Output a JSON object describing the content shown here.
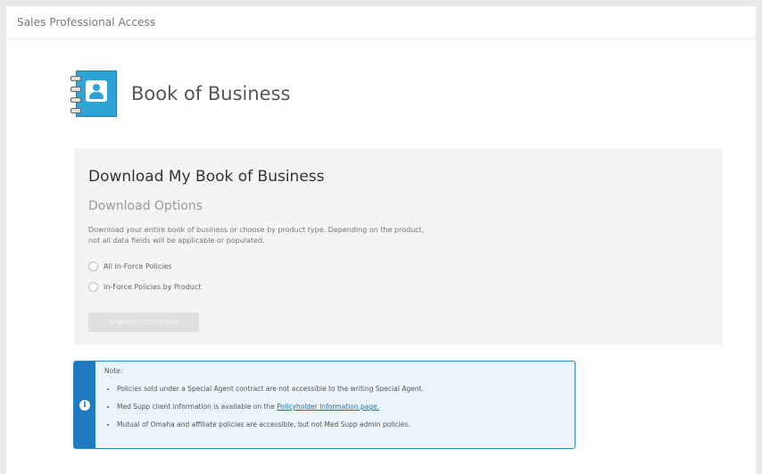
{
  "header": {
    "title": "Sales Professional Access"
  },
  "page": {
    "title": "Book of Business",
    "icon": "address-book-icon",
    "icon_color": "#2ea3d6"
  },
  "download": {
    "title": "Download My Book of Business",
    "subtitle": "Download Options",
    "description": "Download your entire book of business or choose by product type. Depending on the product, not all data fields will be applicable or populated.",
    "options": [
      {
        "label": "All In-Force Policies",
        "selected": false
      },
      {
        "label": "In-Force Policies by Product",
        "selected": false
      }
    ],
    "button_label": "Download CSV to save"
  },
  "note": {
    "label": "Note:",
    "icon": "info-icon",
    "accent_color": "#1f7bc1",
    "items": [
      {
        "text": "Policies sold under a Special Agent contract are not accessible to the writing Special Agent."
      },
      {
        "text_before": "Med Supp client information is available on the ",
        "link": "Policyholder Information page."
      },
      {
        "text": "Mutual of Omaha and affiliate policies are accessible, but not Med Supp admin policies."
      }
    ]
  }
}
